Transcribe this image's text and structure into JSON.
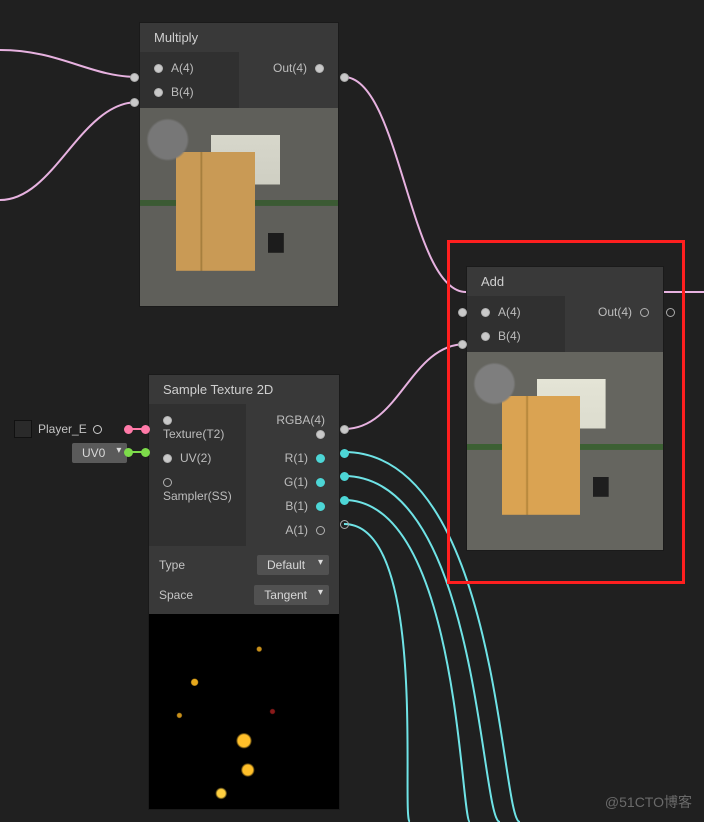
{
  "nodes": {
    "multiply": {
      "title": "Multiply",
      "inputs": {
        "a": "A(4)",
        "b": "B(4)"
      },
      "outputs": {
        "out": "Out(4)"
      }
    },
    "sample": {
      "title": "Sample Texture 2D",
      "inputs": {
        "texture": "Texture(T2)",
        "uv": "UV(2)",
        "sampler": "Sampler(SS)"
      },
      "outputs": {
        "rgba": "RGBA(4)",
        "r": "R(1)",
        "g": "G(1)",
        "b": "B(1)",
        "a": "A(1)"
      },
      "props": {
        "type_label": "Type",
        "type_value": "Default",
        "space_label": "Space",
        "space_value": "Tangent"
      }
    },
    "add": {
      "title": "Add",
      "inputs": {
        "a": "A(4)",
        "b": "B(4)"
      },
      "outputs": {
        "out": "Out(4)"
      }
    }
  },
  "external": {
    "texture_label": "Player_E",
    "uv_label": "UV0"
  },
  "watermark": "@51CTO博客"
}
